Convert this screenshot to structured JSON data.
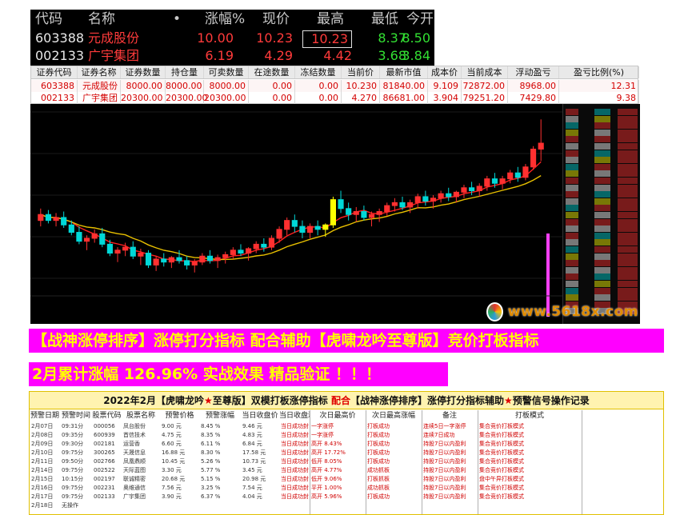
{
  "quote_panel": {
    "headers": [
      "代码",
      "名称",
      "•",
      "涨幅%",
      "现价",
      "最高",
      "最低",
      "今开"
    ],
    "rows": [
      {
        "code": "603388",
        "name": "元成股份",
        "change_pct": "10.00",
        "price": "10.23",
        "high": "10.23",
        "low": "8.37",
        "open": "8.50"
      },
      {
        "code": "002133",
        "name": "广宇集团",
        "change_pct": "6.19",
        "price": "4.29",
        "high": "4.42",
        "low": "3.68",
        "open": "3.84"
      }
    ]
  },
  "holdings": {
    "headers": [
      "证券代码",
      "证券名称",
      "证券数量",
      "持仓量",
      "可卖数量",
      "在途数量",
      "冻结数量",
      "当前价",
      "最新市值",
      "成本价",
      "当前成本",
      "浮动盈亏",
      "盈亏比例(%)"
    ],
    "rows": [
      [
        "603388",
        "元成股份",
        "8000.00",
        "8000.00",
        "8000.00",
        "0.00",
        "0.00",
        "10.230",
        "81840.00",
        "9.109",
        "72872.00",
        "8968.00",
        "12.31"
      ],
      [
        "002133",
        "广宇集团",
        "20300.00",
        "20300.00",
        "20300.00",
        "0.00",
        "0.00",
        "4.270",
        "86681.00",
        "3.904",
        "79251.20",
        "7429.80",
        "9.38"
      ]
    ]
  },
  "chart": {
    "colors": {
      "up": "#ff3030",
      "down": "#00d8d8",
      "ma1": "#ff2020",
      "ma2": "#e8c000",
      "special": "#ffff00",
      "vol": "#ff40ff"
    },
    "candles": [
      [
        3.9,
        3.98,
        3.86,
        3.94
      ],
      [
        3.94,
        3.97,
        3.88,
        3.9
      ],
      [
        3.9,
        3.95,
        3.86,
        3.92
      ],
      [
        3.92,
        3.96,
        3.85,
        3.87
      ],
      [
        3.87,
        3.9,
        3.8,
        3.82
      ],
      [
        3.82,
        3.86,
        3.74,
        3.76
      ],
      [
        3.76,
        3.8,
        3.7,
        3.78
      ],
      [
        3.78,
        3.84,
        3.75,
        3.81
      ],
      [
        3.81,
        3.85,
        3.72,
        3.74
      ],
      [
        3.74,
        3.77,
        3.66,
        3.68
      ],
      [
        3.68,
        3.72,
        3.62,
        3.7
      ],
      [
        3.7,
        3.75,
        3.66,
        3.72
      ],
      [
        3.72,
        3.76,
        3.64,
        3.66
      ],
      [
        3.66,
        3.71,
        3.6,
        3.68
      ],
      [
        3.68,
        3.7,
        3.58,
        3.6
      ],
      [
        3.6,
        3.66,
        3.56,
        3.64
      ],
      [
        3.64,
        3.68,
        3.59,
        3.62
      ],
      [
        3.62,
        3.66,
        3.58,
        3.65
      ],
      [
        3.65,
        3.7,
        3.61,
        3.63
      ],
      [
        3.63,
        3.66,
        3.57,
        3.6
      ],
      [
        3.6,
        3.64,
        3.55,
        3.62
      ],
      [
        3.62,
        3.68,
        3.6,
        3.66
      ],
      [
        3.66,
        3.7,
        3.61,
        3.63
      ],
      [
        3.63,
        3.67,
        3.58,
        3.65
      ],
      [
        3.65,
        3.69,
        3.61,
        3.67
      ],
      [
        3.67,
        3.72,
        3.64,
        3.7
      ],
      [
        3.7,
        3.74,
        3.66,
        3.68
      ],
      [
        3.68,
        3.72,
        3.63,
        3.71
      ],
      [
        3.71,
        3.76,
        3.68,
        3.74
      ],
      [
        3.74,
        3.78,
        3.69,
        3.72
      ],
      [
        3.72,
        3.8,
        3.7,
        3.78
      ],
      [
        3.78,
        3.86,
        3.75,
        3.84
      ],
      [
        3.84,
        3.92,
        3.8,
        3.9
      ],
      [
        3.9,
        3.94,
        3.82,
        3.86
      ],
      [
        3.86,
        3.9,
        3.78,
        3.82
      ],
      [
        3.82,
        3.88,
        3.78,
        3.86
      ],
      [
        3.86,
        3.9,
        3.8,
        3.84
      ],
      [
        3.84,
        3.88,
        3.79,
        3.87
      ],
      [
        3.87,
        4.06,
        3.85,
        4.04
      ],
      [
        4.04,
        4.1,
        3.95,
        3.98
      ],
      [
        3.98,
        4.02,
        3.9,
        3.94
      ],
      [
        3.94,
        3.99,
        3.89,
        3.96
      ],
      [
        3.96,
        4.0,
        3.9,
        3.92
      ],
      [
        3.92,
        3.96,
        3.86,
        3.94
      ],
      [
        3.94,
        3.98,
        3.89,
        3.96
      ],
      [
        3.96,
        4.02,
        3.93,
        4.0
      ],
      [
        4.0,
        4.05,
        3.96,
        4.02
      ],
      [
        4.02,
        4.06,
        3.97,
        3.99
      ],
      [
        3.99,
        4.04,
        3.95,
        4.02
      ],
      [
        4.02,
        4.08,
        3.98,
        4.06
      ],
      [
        4.06,
        4.1,
        4.0,
        4.03
      ],
      [
        4.03,
        4.07,
        3.98,
        4.05
      ],
      [
        4.05,
        4.1,
        4.02,
        4.08
      ],
      [
        4.08,
        4.12,
        4.03,
        4.06
      ],
      [
        4.06,
        4.1,
        4.02,
        4.09
      ],
      [
        4.09,
        4.14,
        4.05,
        4.12
      ],
      [
        4.12,
        4.16,
        4.07,
        4.1
      ],
      [
        4.1,
        4.15,
        4.06,
        4.13
      ],
      [
        4.13,
        4.2,
        4.1,
        4.18
      ],
      [
        4.18,
        4.22,
        4.12,
        4.15
      ],
      [
        4.15,
        4.2,
        4.11,
        4.18
      ],
      [
        4.18,
        4.24,
        4.15,
        4.22
      ],
      [
        4.22,
        4.26,
        4.16,
        4.19
      ],
      [
        4.19,
        4.28,
        4.17,
        4.26
      ],
      [
        4.26,
        4.4,
        4.24,
        4.38
      ],
      [
        4.38,
        4.58,
        4.3,
        4.42
      ]
    ],
    "special_candles": [
      37,
      38
    ],
    "volume_bars": [
      4,
      9,
      14,
      7
    ]
  },
  "watermark": {
    "text": "www.5618x.com"
  },
  "banners": {
    "line1": "【战神涨停排序】涨停打分指标 配合辅助【虎啸龙吟至尊版】竞价打板指标",
    "line2": "2月累计涨幅 126.96% 实战效果 精品验证 ！！！"
  },
  "records": {
    "title_a": "2022年2月【虎啸龙吟",
    "title_star": "★",
    "title_b": "至尊版】双模打板涨停指标",
    "title_with": " 配合",
    "title_c": "【战神涨停排序】涨停打分指标辅助",
    "title_d": "预警信号操作记录",
    "headers": [
      "预警日期",
      "预警时间",
      "股票代码",
      "股票名称",
      "预警价格",
      "预警涨幅",
      "当日收盘价",
      "当日收盘涨幅",
      "次日最高价",
      "次日最高涨幅",
      "备注",
      "打板模式"
    ],
    "rows": [
      [
        "2月07日",
        "09:31分",
        "000056",
        "凤台股份",
        "9.00 元",
        "8.45 %",
        "9.46 元",
        "当日成功封板",
        "一字涨停",
        "打板成功",
        "连续5日一字涨停",
        "集合竞价打板模式"
      ],
      [
        "2月08日",
        "09:35分",
        "600939",
        "首信技术",
        "4.75 元",
        "8.35 %",
        "4.83 元",
        "当日成功封板",
        "一字涨停",
        "打板成功",
        "连续7日成功",
        "集合竞价打板模式"
      ],
      [
        "2月09日",
        "09:30分",
        "002181",
        "运营香",
        "6.60 元",
        "6.11 %",
        "6.84 元",
        "当日成功封板",
        "高开 8.43%",
        "打板成功",
        "持股7日以内盈利",
        "集合竞价打板模式"
      ],
      [
        "2月10日",
        "09:75分",
        "300265",
        "天晟信息",
        "16.88 元",
        "8.30 %",
        "17.58 元",
        "当日成功封板",
        "高开 17.72%",
        "打板成功",
        "持股7日以内盈利",
        "集合竞价打板模式"
      ],
      [
        "2月11日",
        "09:50分",
        "002766",
        "凤凰鼎顺",
        "10.45 元",
        "5.26 %",
        "10.73 元",
        "当日成功封板",
        "低开 8.05%",
        "打板成功",
        "持股7日以内盈利",
        "集合竞价打板模式"
      ],
      [
        "2月14日",
        "09:75分",
        "002522",
        "天际蓝图",
        "3.30 元",
        "5.77 %",
        "3.45 元",
        "当日成功封板",
        "高开 4.77%",
        "成功抓板",
        "持股7日以内盈利",
        "集合竞价打板模式"
      ],
      [
        "2月15日",
        "10:15分",
        "002197",
        "联诚精密",
        "20.68 元",
        "5.15 %",
        "20.98 元",
        "当日成功封板",
        "低开 9.06%",
        "打板抓板",
        "持股7日以内盈利",
        "盘中午异打板模式"
      ],
      [
        "2月16日",
        "09:75分",
        "002231",
        "奥维通信",
        "7.56 元",
        "3.25 %",
        "7.54 元",
        "当日成功封板",
        "平开 1.00%",
        "成功抓板",
        "持股7日以内盈利",
        "集合竞价打板模式"
      ],
      [
        "2月17日",
        "09:75分",
        "002133",
        "广宇集团",
        "3.90 元",
        "6.37 %",
        "4.04 元",
        "当日成功封板",
        "高开 5.96%",
        "打板成功",
        "持股7日以内盈利",
        "集合竞价打板模式"
      ],
      [
        "2月18日",
        "无操作",
        "",
        "",
        "",
        "",
        "",
        "",
        "",
        "",
        "",
        ""
      ]
    ]
  }
}
